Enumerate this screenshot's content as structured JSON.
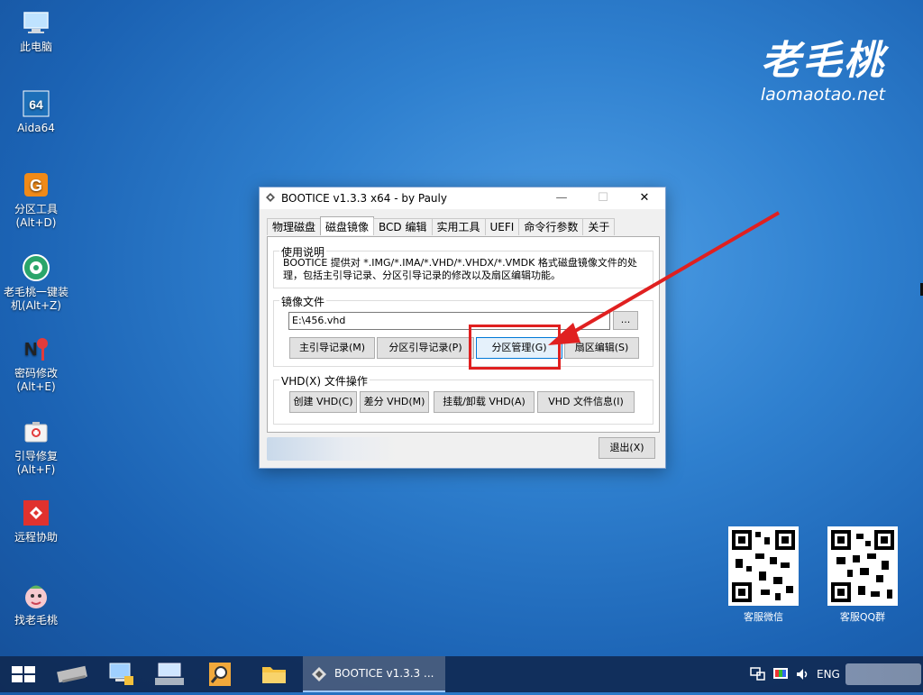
{
  "desktop": {
    "icons": [
      {
        "label": "此电脑",
        "icon": "computer-icon"
      },
      {
        "label": "Aida64",
        "icon": "aida64-icon"
      },
      {
        "label": "分区工具\n(Alt+D)",
        "icon": "partition-tool-icon"
      },
      {
        "label": "老毛桃一键装\n机(Alt+Z)",
        "icon": "one-key-install-icon"
      },
      {
        "label": "密码修改\n(Alt+E)",
        "icon": "password-change-icon"
      },
      {
        "label": "引导修复\n(Alt+F)",
        "icon": "boot-repair-icon"
      },
      {
        "label": "远程协助",
        "icon": "remote-assist-icon"
      },
      {
        "label": "找老毛桃",
        "icon": "find-laomaotao-icon"
      }
    ],
    "brand": {
      "cn": "老毛桃",
      "en": "laomaotao.net"
    },
    "qr_codes": [
      {
        "label": "客服微信"
      },
      {
        "label": "客服QQ群"
      }
    ]
  },
  "window": {
    "title": "BOOTICE v1.3.3 x64 - by Pauly",
    "controls": {
      "minimize": "—",
      "maximize": "☐",
      "close": "✕"
    },
    "tabs": [
      "物理磁盘",
      "磁盘镜像",
      "BCD 编辑",
      "实用工具",
      "UEFI",
      "命令行参数",
      "关于"
    ],
    "active_tab": "磁盘镜像",
    "usage": {
      "label": "使用说明",
      "text": "BOOTICE 提供对 *.IMG/*.IMA/*.VHD/*.VHDX/*.VMDK 格式磁盘镜像文件的处理，包括主引导记录、分区引导记录的修改以及扇区编辑功能。"
    },
    "image_file": {
      "label": "镜像文件",
      "path_value": "E:\\456.vhd",
      "browse_label": "...",
      "buttons": {
        "mbr": "主引导记录(M)",
        "pbr": "分区引导记录(P)",
        "partition_mgmt": "分区管理(G)",
        "sector_edit": "扇区编辑(S)"
      }
    },
    "vhd_ops": {
      "label": "VHD(X) 文件操作",
      "buttons": {
        "create": "创建 VHD(C)",
        "diff": "差分 VHD(M)",
        "mount": "挂载/卸载 VHD(A)",
        "info": "VHD 文件信息(I)"
      }
    },
    "exit_label": "退出(X)"
  },
  "taskbar": {
    "active_task": "BOOTICE v1.3.3 ...",
    "language": "ENG"
  },
  "colors": {
    "annotation_red": "#e02020",
    "focus_blue": "#0078d7"
  }
}
